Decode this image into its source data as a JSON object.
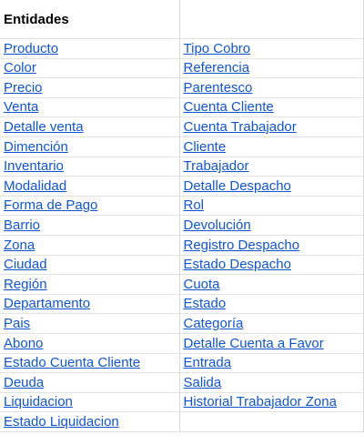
{
  "header": {
    "title": "Entidades",
    "second": ""
  },
  "rows": [
    [
      "Producto",
      "Tipo Cobro"
    ],
    [
      "Color",
      "Referencia"
    ],
    [
      "Precio",
      "Parentesco"
    ],
    [
      "Venta",
      "Cuenta Cliente"
    ],
    [
      "Detalle venta",
      "Cuenta Trabajador"
    ],
    [
      "Dimención",
      "Cliente"
    ],
    [
      "Inventario",
      "Trabajador "
    ],
    [
      "Modalidad",
      "Detalle Despacho"
    ],
    [
      "Forma de Pago ",
      "Rol"
    ],
    [
      "Barrio",
      "Devolución"
    ],
    [
      "Zona",
      "Registro Despacho"
    ],
    [
      "Ciudad",
      "Estado Despacho"
    ],
    [
      "Región",
      "Cuota"
    ],
    [
      "Departamento",
      "Estado"
    ],
    [
      "Pais",
      "Categoría"
    ],
    [
      "Abono",
      "Detalle Cuenta a Favor "
    ],
    [
      "Estado Cuenta Cliente",
      "Entrada"
    ],
    [
      "Deuda",
      "Salida"
    ],
    [
      "Liquidacion",
      "Historial Trabajador Zona"
    ],
    [
      "Estado Liquidacion",
      ""
    ]
  ],
  "colors": {
    "link": "#1155cc",
    "gridline": "#d9d9d9"
  }
}
